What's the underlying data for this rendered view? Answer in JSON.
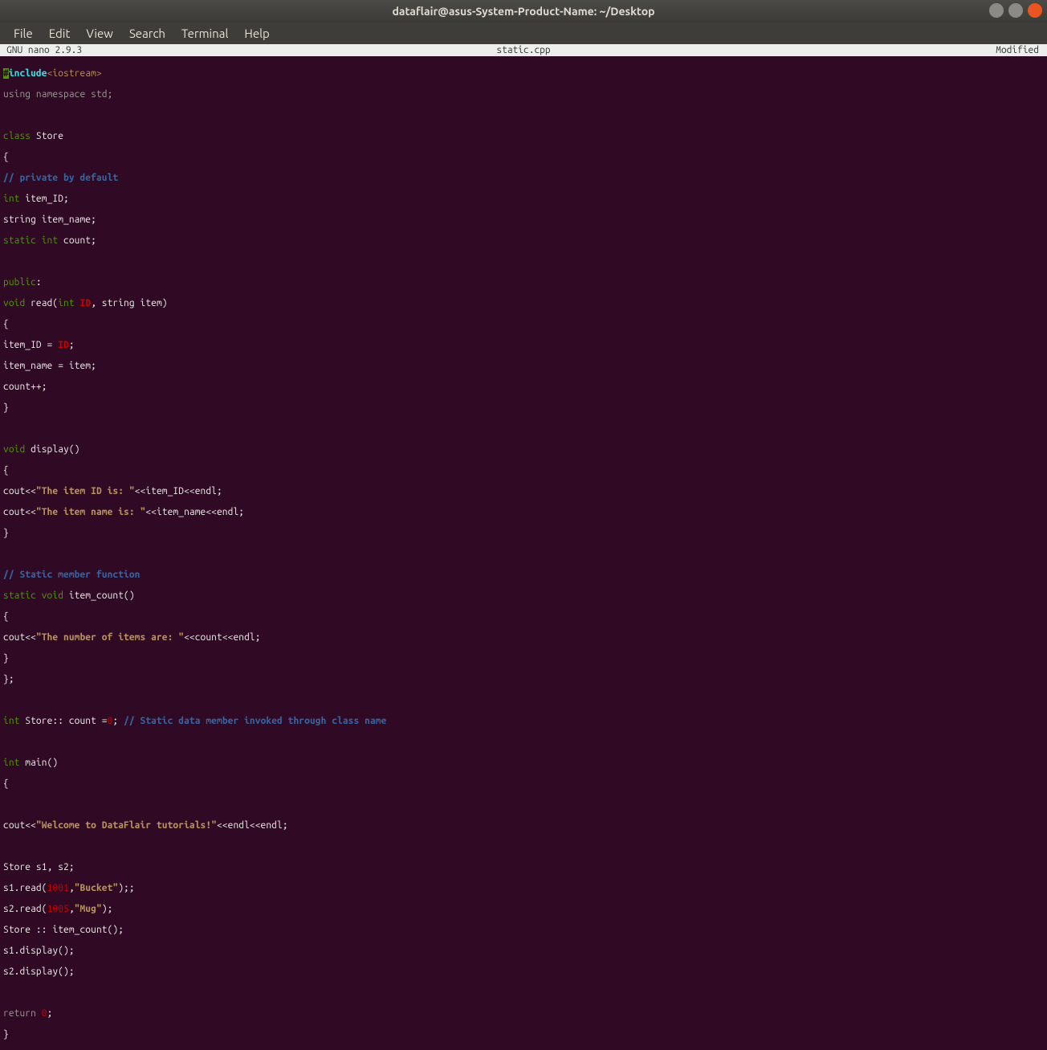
{
  "window": {
    "title": "dataflair@asus-System-Product-Name: ~/Desktop"
  },
  "menu": {
    "file": "File",
    "edit": "Edit",
    "view": "View",
    "search": "Search",
    "terminal": "Terminal",
    "help": "Help"
  },
  "nano": {
    "version": "  GNU nano 2.9.3",
    "filename": "static.cpp",
    "status": "Modified "
  },
  "code": {
    "l01a": "#",
    "l01b": "include",
    "l01c": "<iostream>",
    "l02a": "using",
    "l02b": " namespace ",
    "l02c": "std;",
    "l04a": "class",
    "l04b": " Store",
    "l05": "{",
    "l06": "// private by default",
    "l07a": "int",
    "l07b": " item_ID;",
    "l08a": "string item_name;",
    "l09a": "static",
    "l09b": " int ",
    "l09c": "count;",
    "l11a": "public",
    "l11b": ":",
    "l12a": "void",
    "l12b": " read(",
    "l12c": "int",
    "l12d": " ",
    "l12e": "ID",
    "l12f": ", string item)",
    "l13": "{",
    "l14a": "item_ID = ",
    "l14b": "ID",
    "l14c": ";",
    "l15": "item_name = item;",
    "l16": "count++;",
    "l17": "}",
    "l19a": "void",
    "l19b": " display()",
    "l20": "{",
    "l21a": "cout<<",
    "l21b": "\"The item ID is: \"",
    "l21c": "<<item_ID<<endl;",
    "l22a": "cout<<",
    "l22b": "\"The item name is: \"",
    "l22c": "<<item_name<<endl;",
    "l23": "}",
    "l25": "// Static member function",
    "l26a": "static",
    "l26b": " void ",
    "l26c": "item_count()",
    "l27": "{",
    "l28a": "cout<<",
    "l28b": "\"The number of items are: \"",
    "l28c": "<<count<<endl;",
    "l29": "}",
    "l30": "};",
    "l32a": "int",
    "l32b": " Store:: count =",
    "l32c": "0",
    "l32d": "; ",
    "l32e": "// Static data member invoked through class name",
    "l34a": "int",
    "l34b": " main()",
    "l35": "{",
    "l37a": "cout<<",
    "l37b": "\"Welcome to DataFlair tutorials!\"",
    "l37c": "<<endl<<endl;",
    "l39": "Store s1, s2;",
    "l40a": "s1.read(",
    "l40b": "1001",
    "l40c": ",",
    "l40d": "\"Bucket\"",
    "l40e": ");;",
    "l41a": "s2.read(",
    "l41b": "1005",
    "l41c": ",",
    "l41d": "\"Mug\"",
    "l41e": ");",
    "l42": "Store :: item_count();",
    "l43": "s1.display();",
    "l44": "s2.display();",
    "l46a": "return",
    "l46b": " ",
    "l46c": "0",
    "l46d": ";",
    "l47": "}"
  }
}
